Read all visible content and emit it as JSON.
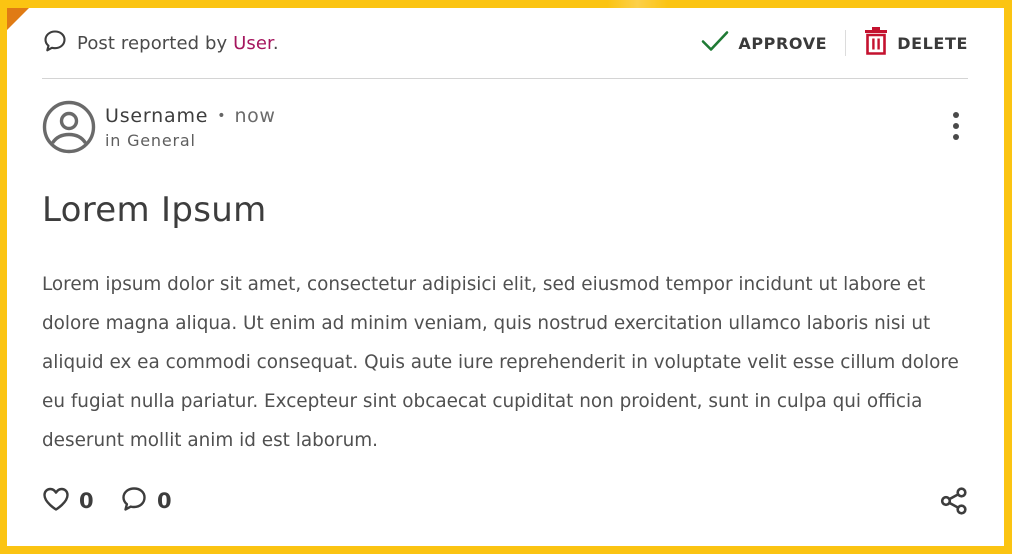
{
  "report": {
    "prefix": "Post reported by ",
    "user": "User",
    "suffix": ".",
    "approve_label": "APPROVE",
    "delete_label": "DELETE"
  },
  "post": {
    "author": "Username",
    "separator": "•",
    "time": "now",
    "category": "in General",
    "title": "Lorem Ipsum",
    "body": "Lorem ipsum dolor sit amet, consectetur adipisici elit, sed eiusmod tempor incidunt ut labore et dolore magna aliqua. Ut enim ad minim veniam, quis nostrud exercitation ullamco laboris nisi ut aliquid ex ea commodi consequat. Quis aute iure reprehenderit in voluptate velit esse cillum dolore eu fugiat nulla pariatur. Excepteur sint obcaecat cupiditat non proident, sunt in culpa qui officia deserunt mollit anim id est laborum.",
    "likes": "0",
    "comments": "0"
  },
  "icons": {
    "report": "speech-bubble-icon",
    "approve": "checkmark-icon",
    "delete": "trash-icon",
    "avatar": "user-avatar-icon",
    "more": "vertical-dots-icon",
    "like": "heart-icon",
    "comment": "comment-bubble-icon",
    "share": "share-icon"
  },
  "colors": {
    "frame": "#fbc412",
    "corner": "#e07b14",
    "user_link": "#a5165e",
    "approve": "#1f7a34",
    "delete": "#c4122f"
  }
}
